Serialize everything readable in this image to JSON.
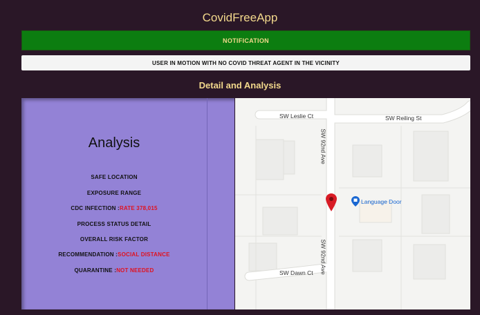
{
  "app": {
    "title": "CovidFreeApp"
  },
  "notification": {
    "label": "NOTIFICATION",
    "message": "USER IN MOTION WITH NO COVID THREAT AGENT IN THE VICINITY"
  },
  "section": {
    "title": "Detail and Analysis"
  },
  "analysis": {
    "heading": "Analysis",
    "rows": [
      {
        "label": "SAFE LOCATION",
        "value": ""
      },
      {
        "label": "EXPOSURE RANGE",
        "value": ""
      },
      {
        "label": "CDC INFECTION :",
        "value": "RATE 378,015"
      },
      {
        "label": "PROCESS STATUS DETAIL",
        "value": ""
      },
      {
        "label": "OVERALL RISK FACTOR",
        "value": ""
      },
      {
        "label": "RECOMMENDATION :",
        "value": "SOCIAL DISTANCE"
      },
      {
        "label": "QUARANTINE :",
        "value": "NOT NEEDED"
      }
    ]
  },
  "map": {
    "streets": {
      "leslie": "SW Leslie Ct",
      "reiling": "SW Reiling St",
      "ave_north": "SW 92nd Ave",
      "ave_south": "SW 92nd Ave",
      "dawn": "SW Dawn Ct"
    },
    "poi": {
      "label": "Language Door",
      "icon": "store-pin-icon"
    },
    "marker": {
      "icon": "location-pin-icon"
    }
  },
  "colors": {
    "background": "#2a1727",
    "accent_text": "#f3d98c",
    "notification_bg": "#0c7d10",
    "analysis_bg": "#9382d6",
    "alert_red": "#e0121f",
    "marker_red": "#d81b25",
    "poi_blue": "#1967d2"
  }
}
